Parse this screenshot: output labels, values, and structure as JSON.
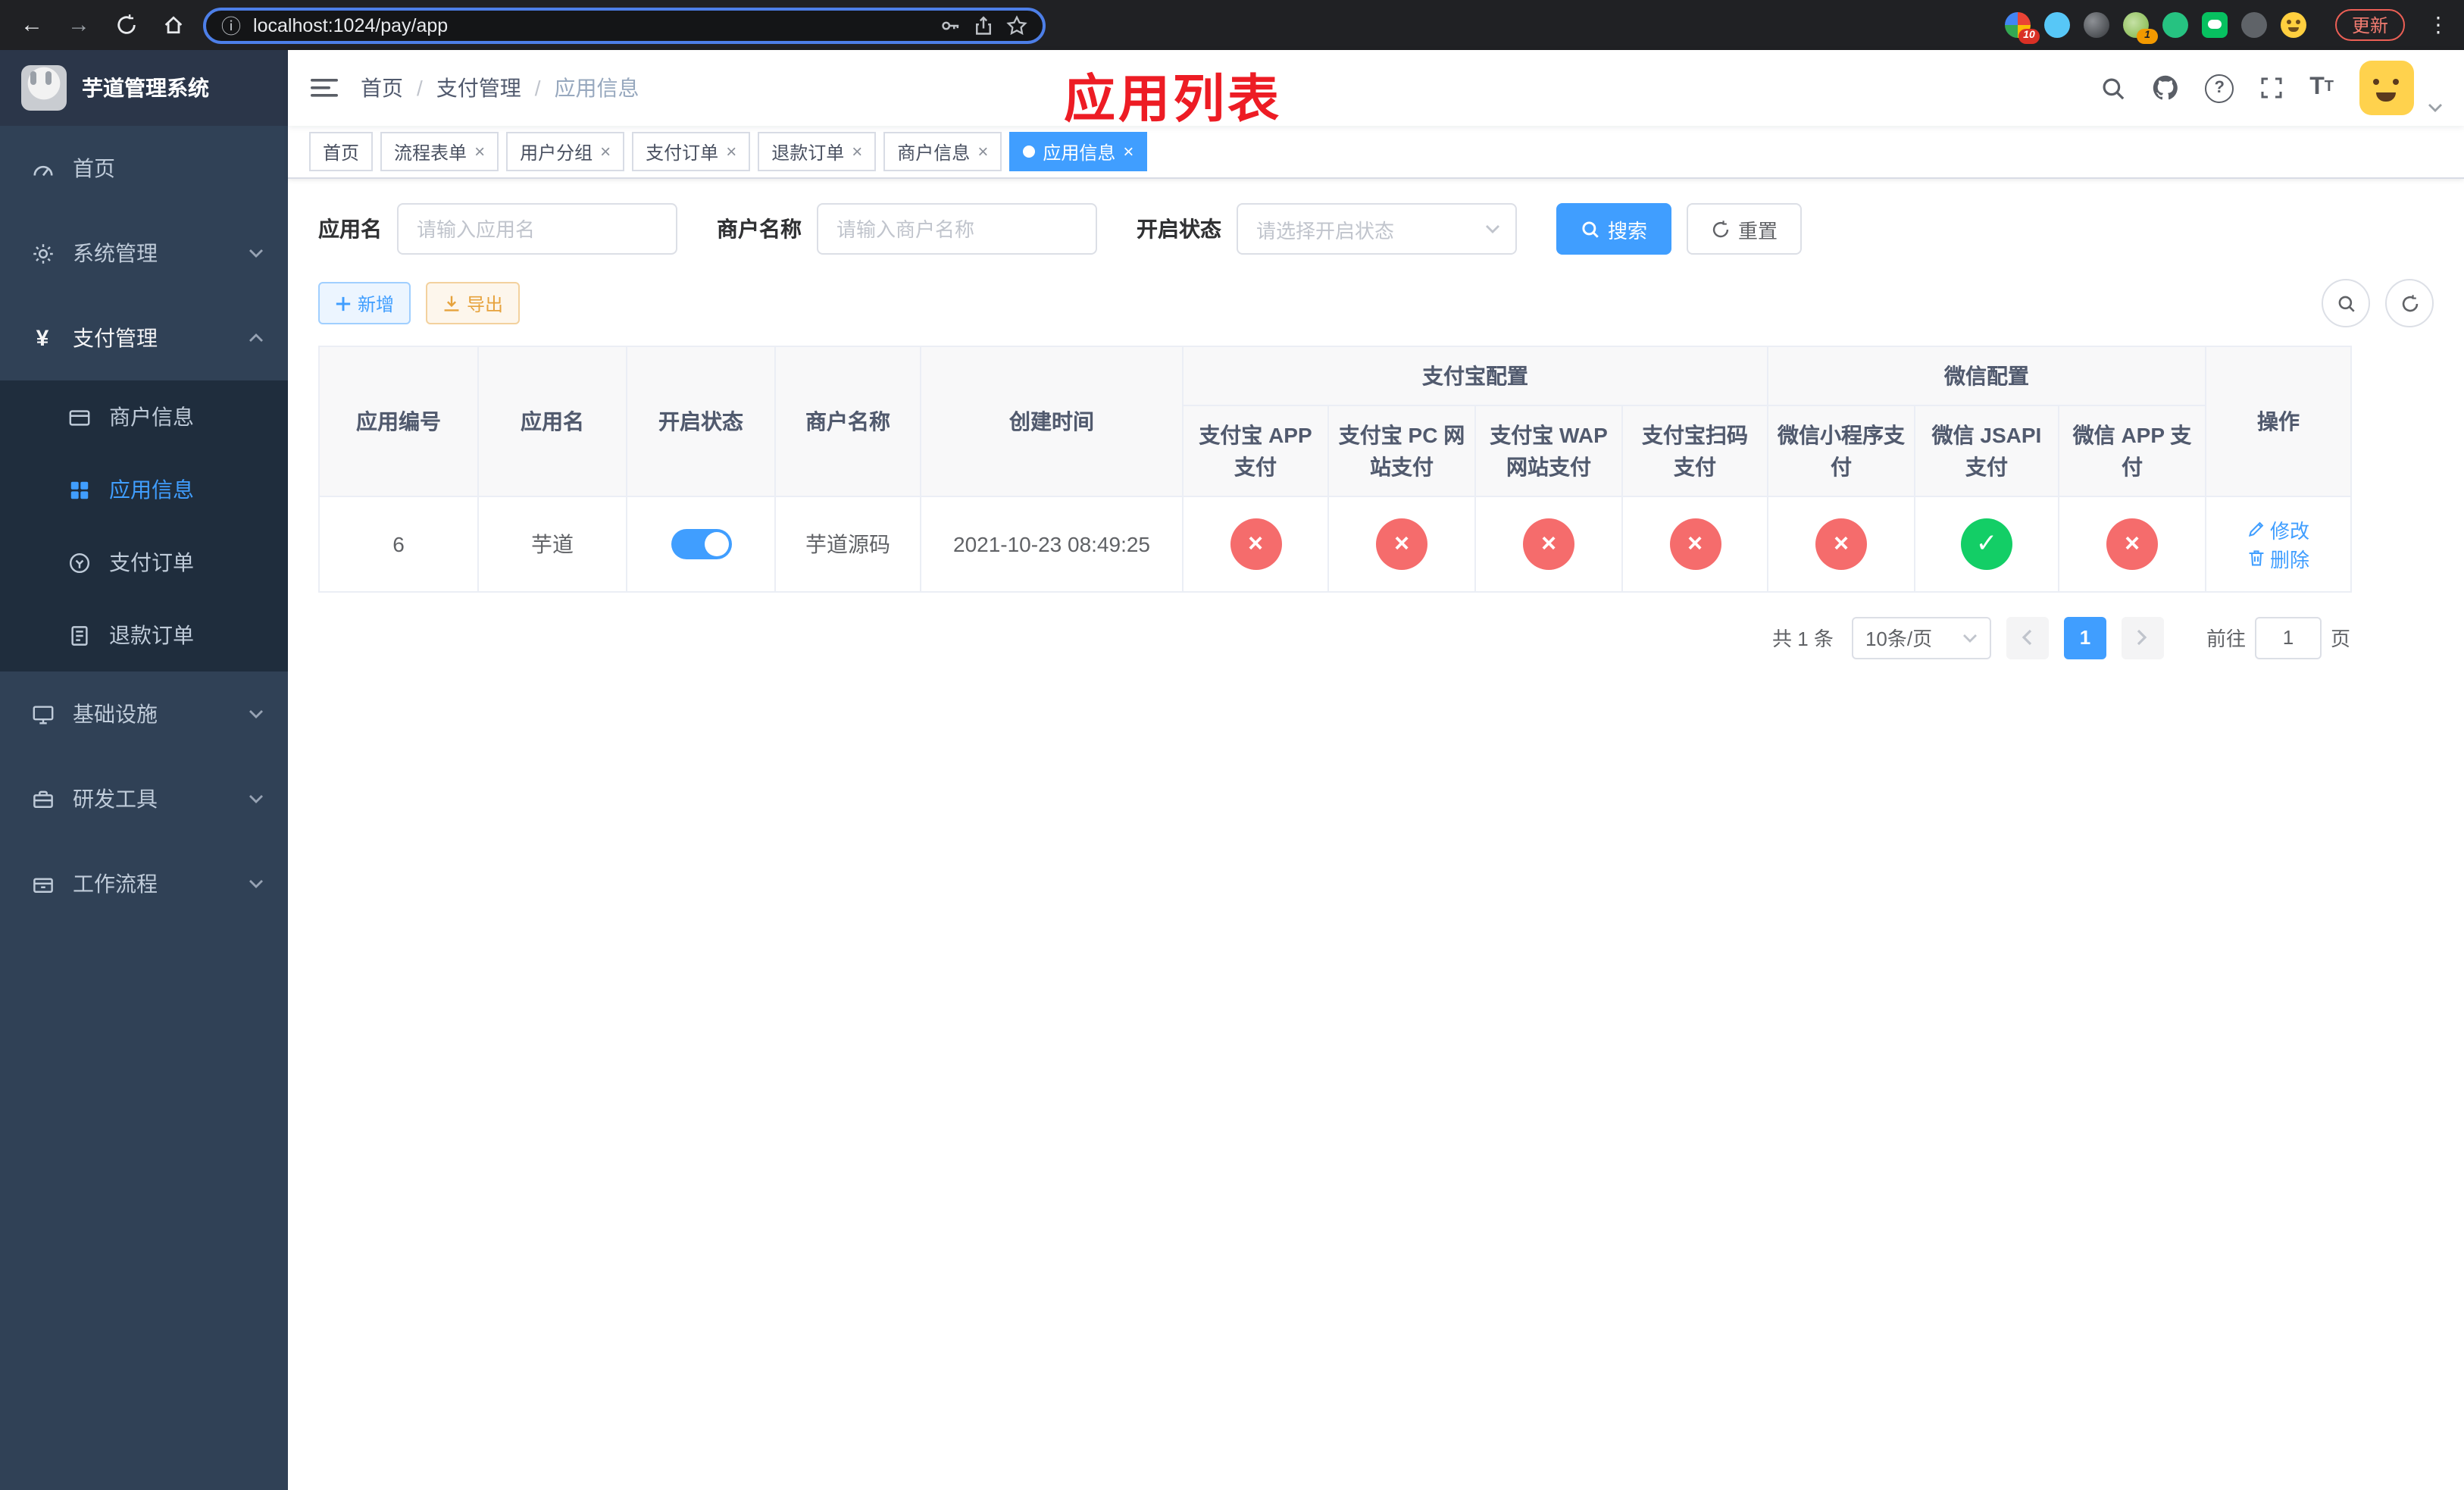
{
  "icons": {
    "back": "←",
    "forward": "→",
    "menu_dots": "⋮",
    "info": "ⓘ",
    "close": "×",
    "check": "✓",
    "cross": "×",
    "separator": "/",
    "question": "?",
    "yen": "¥",
    "font_size_large": "T",
    "font_size_small": "T"
  },
  "browser": {
    "url": "localhost:1024/pay/app",
    "update_label": "更新",
    "extension_badges": {
      "first": "10",
      "second": "1"
    }
  },
  "sidebar": {
    "title": "芋道管理系统",
    "menu": [
      {
        "label": "首页"
      },
      {
        "label": "系统管理"
      },
      {
        "label": "支付管理",
        "children": [
          {
            "label": "商户信息"
          },
          {
            "label": "应用信息"
          },
          {
            "label": "支付订单"
          },
          {
            "label": "退款订单"
          }
        ]
      },
      {
        "label": "基础设施"
      },
      {
        "label": "研发工具"
      },
      {
        "label": "工作流程"
      }
    ]
  },
  "breadcrumb": [
    "首页",
    "支付管理",
    "应用信息"
  ],
  "annotation": "应用列表",
  "tabs": [
    {
      "label": "首页"
    },
    {
      "label": "流程表单"
    },
    {
      "label": "用户分组"
    },
    {
      "label": "支付订单"
    },
    {
      "label": "退款订单"
    },
    {
      "label": "商户信息"
    },
    {
      "label": "应用信息"
    }
  ],
  "filters": {
    "app_name_label": "应用名",
    "app_name_placeholder": "请输入应用名",
    "merchant_label": "商户名称",
    "merchant_placeholder": "请输入商户名称",
    "status_label": "开启状态",
    "status_placeholder": "请选择开启状态",
    "search_label": "搜索",
    "reset_label": "重置"
  },
  "toolbar": {
    "add_label": "新增",
    "export_label": "导出"
  },
  "table": {
    "base_columns": [
      "应用编号",
      "应用名",
      "开启状态",
      "商户名称",
      "创建时间"
    ],
    "alipay_group": "支付宝配置",
    "wechat_group": "微信配置",
    "alipay_columns": [
      "支付宝 APP 支付",
      "支付宝 PC 网站支付",
      "支付宝 WAP 网站支付",
      "支付宝扫码支付"
    ],
    "wechat_columns": [
      "微信小程序支付",
      "微信 JSAPI 支付",
      "微信 APP 支付"
    ],
    "op_column": "操作",
    "row": {
      "id": "6",
      "name": "芋道",
      "enabled": true,
      "merchant": "芋道源码",
      "created_at": "2021-10-23 08:49:25",
      "statuses": {
        "alipay_app": false,
        "alipay_pc": false,
        "alipay_wap": false,
        "alipay_qr": false,
        "wechat_mini": false,
        "wechat_jsapi": true,
        "wechat_app": false
      },
      "edit_label": "修改",
      "delete_label": "删除"
    }
  },
  "pagination": {
    "total_label": "共 1 条",
    "page_size_label": "10条/页",
    "current_page": "1",
    "goto_label": "前往",
    "goto_value": "1",
    "goto_unit": "页"
  },
  "colors": {
    "primary": "#409eff",
    "success": "#13ce66",
    "danger": "#f56c6c",
    "warning": "#e6a23c",
    "sidebar_bg": "#304156",
    "sidebar_submenu_bg": "#1f2d3d",
    "annotation_red": "#ed1c24",
    "browser_bar_bg": "#202124",
    "omnibox_focus_ring": "#4d7fe8"
  }
}
